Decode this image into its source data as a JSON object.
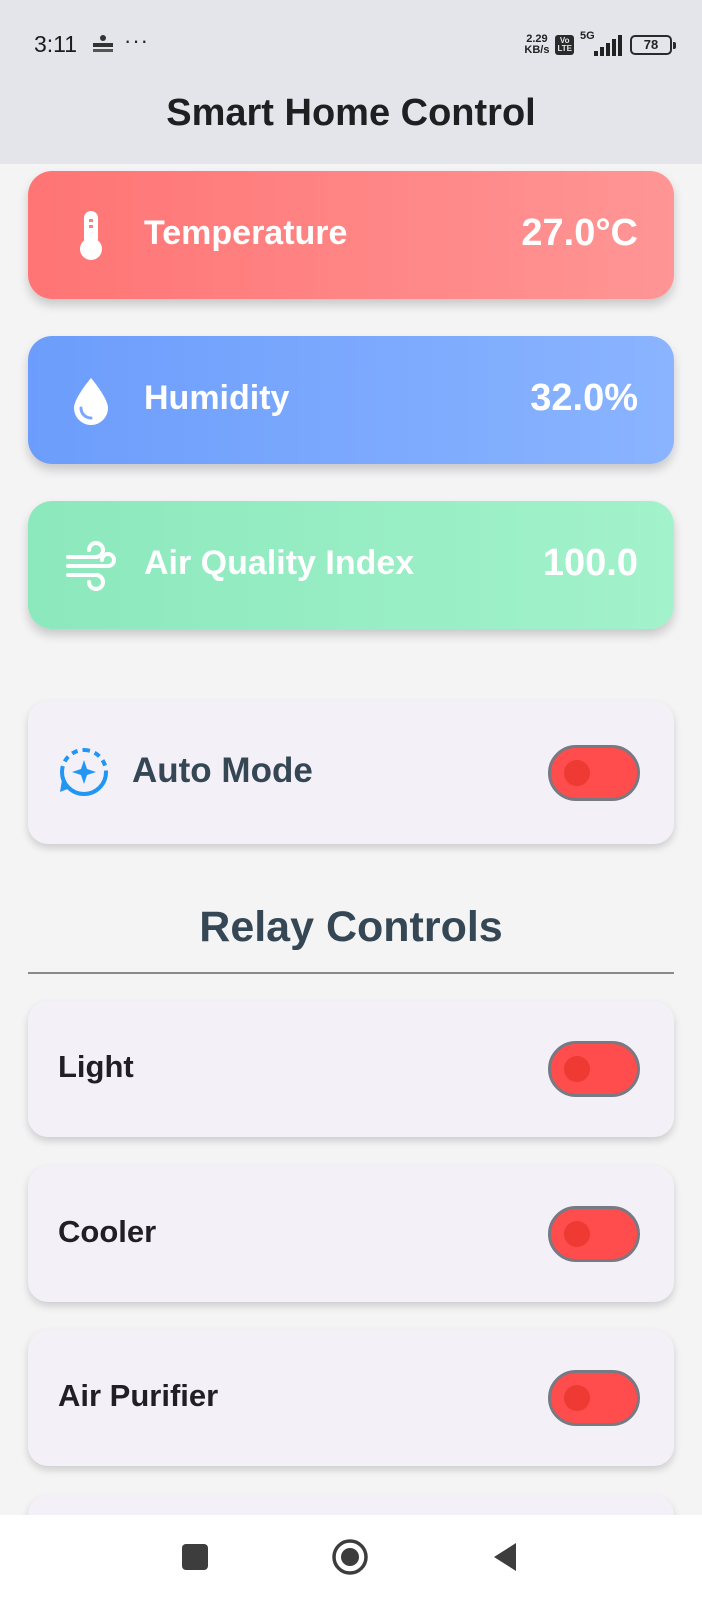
{
  "status_bar": {
    "time": "3:11",
    "more": "···",
    "net_speed_value": "2.29",
    "net_speed_unit": "KB/s",
    "volte_top": "Vo",
    "volte_bottom": "LTE",
    "network": "5G",
    "battery": "78"
  },
  "app_bar": {
    "title": "Smart Home Control"
  },
  "sensors": [
    {
      "label": "Temperature",
      "value": "27.0°C",
      "icon": "thermometer-icon",
      "color": "#ff7474"
    },
    {
      "label": "Humidity",
      "value": "32.0%",
      "icon": "water-drop-icon",
      "color": "#6c9dfc"
    },
    {
      "label": "Air Quality Index",
      "value": "100.0",
      "icon": "wind-icon",
      "color": "#8ce8bd"
    }
  ],
  "auto_mode": {
    "label": "Auto Mode",
    "icon": "auto-mode-icon",
    "enabled": false,
    "accent": "#2196f3"
  },
  "relay_section": {
    "title": "Relay Controls"
  },
  "relays": [
    {
      "label": "Light",
      "enabled": false
    },
    {
      "label": "Cooler",
      "enabled": false
    },
    {
      "label": "Air Purifier",
      "enabled": false
    },
    {
      "label": "",
      "enabled": false
    }
  ],
  "switch_colors": {
    "track_off": "#ff4c4c",
    "knob_off": "#ee3a33",
    "border": "#777983"
  },
  "nav_bar": {
    "icons": [
      "recent-apps-icon",
      "home-icon",
      "back-icon"
    ]
  }
}
